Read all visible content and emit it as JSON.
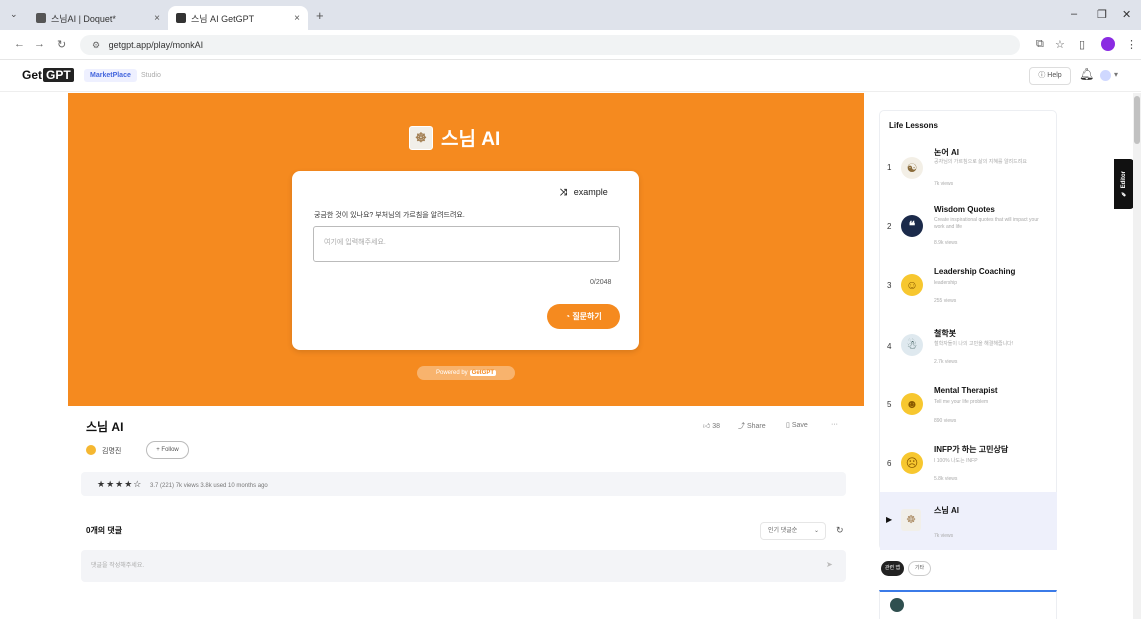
{
  "browser": {
    "tabs": [
      {
        "label": "스님AI | Doquet*",
        "active": false
      },
      {
        "label": "스님 AI GetGPT",
        "active": true
      }
    ],
    "url": "getgpt.app/play/monkAI",
    "close_glyph": "×",
    "new_tab_glyph": "+"
  },
  "header": {
    "logo_text": "Get",
    "logo_badge": "GPT",
    "nav_marketplace": "MarketPlace",
    "nav_studio": "Studio",
    "help_label": "Help"
  },
  "hero": {
    "title": "스님 AI",
    "bg_color": "#f58a1f",
    "example_label": "example",
    "prompt_label": "궁금한 것이 있나요? 부처님의 가르침을 알려드려요.",
    "input_placeholder": "여기에 입력해주세요.",
    "char_counter": "0/2048",
    "submit_label": "질문하기",
    "powered_by_prefix": "Powered by",
    "powered_by_brand": "GetGPT"
  },
  "app_info": {
    "name": "스님 AI",
    "author": "김명진",
    "follow_label": "+ Follow",
    "likes": "38",
    "share_label": "Share",
    "save_label": "Save",
    "more_label": "···",
    "rating_stars": "★★★★☆",
    "stats_text": "3.7 (221)  7k views  3.8k used  10 months ago"
  },
  "comments": {
    "title": "0개의 댓글",
    "sort_label": "인기 댓글순",
    "input_placeholder": "댓글을 작성해주세요."
  },
  "sidebar": {
    "title": "Life Lessons",
    "items": [
      {
        "num": "1",
        "title": "논어 AI",
        "desc": "공자님의 가르침으로 삶의 지혜를 알려드려요",
        "views": "7k views"
      },
      {
        "num": "2",
        "title": "Wisdom Quotes",
        "desc": "Create inspirational quotes that will impact your work and life",
        "views": "8.9k views"
      },
      {
        "num": "3",
        "title": "Leadership Coaching",
        "desc": "leadership",
        "views": "255 views"
      },
      {
        "num": "4",
        "title": "철학봇",
        "desc": "철학자들이 나의 고민을 해결해줍니다!",
        "views": "2.7k views"
      },
      {
        "num": "5",
        "title": "Mental Therapist",
        "desc": "Tell me your life problem",
        "views": "890 views"
      },
      {
        "num": "6",
        "title": "INFP가 하는 고민상담",
        "desc": "I 100% 나도는 INFP",
        "views": "5.8k views"
      }
    ],
    "current": {
      "title": "스님 AI",
      "views": "7k views"
    },
    "chip_related": "관련 앱",
    "chip_other": "기타",
    "editor_label": "Editor"
  }
}
